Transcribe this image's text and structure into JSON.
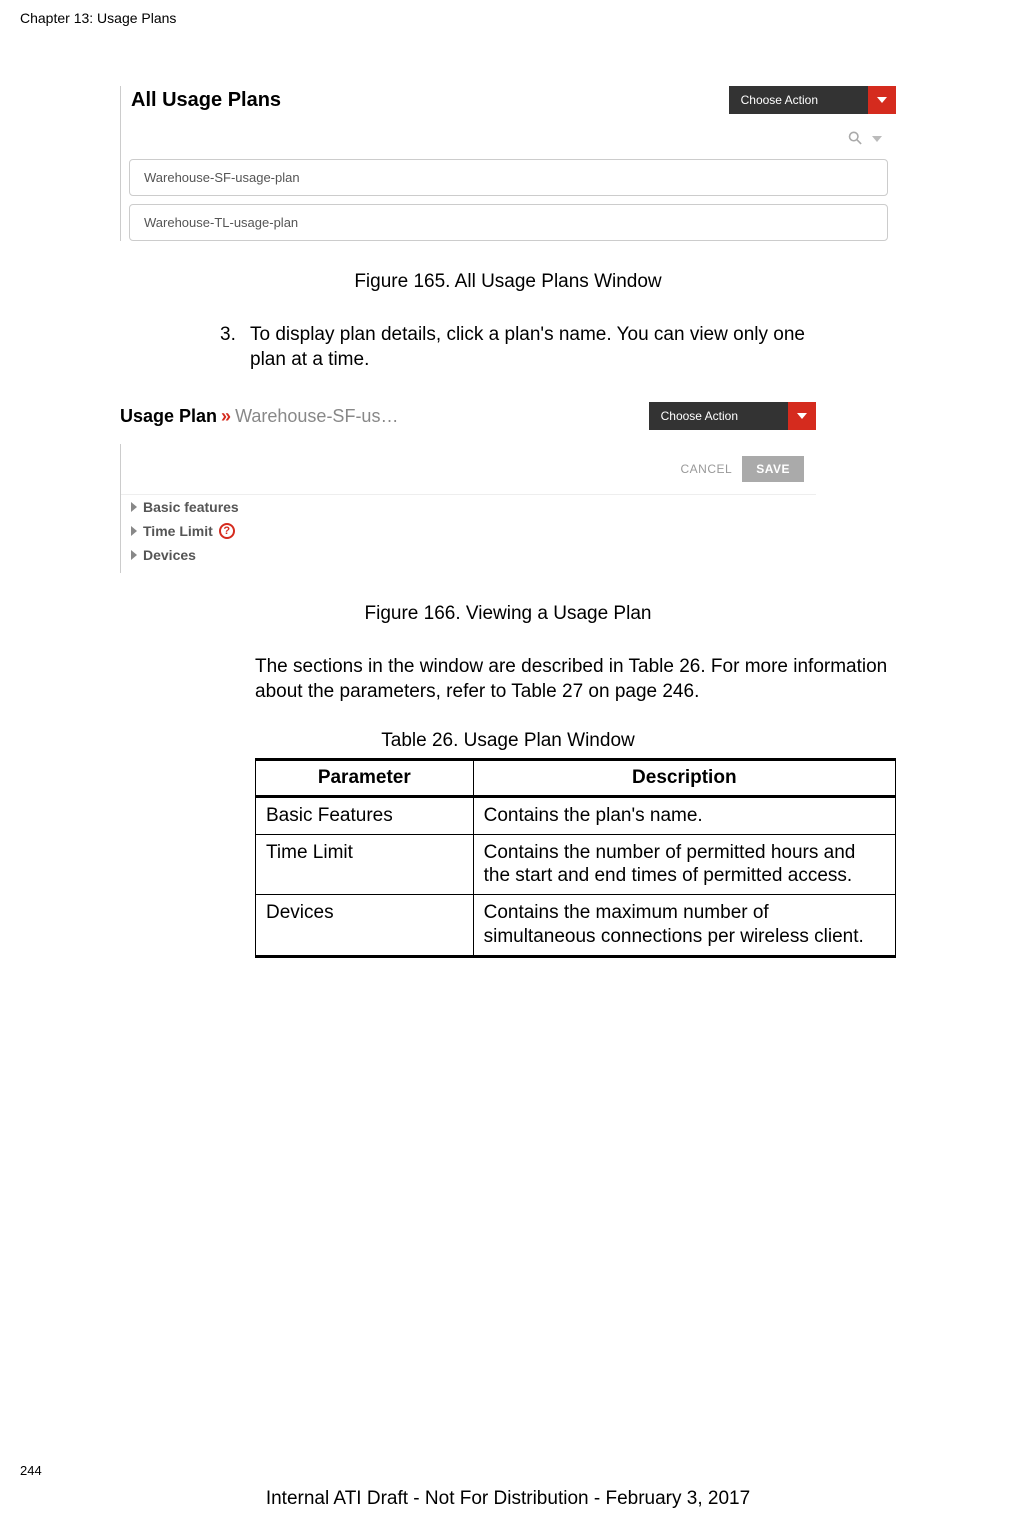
{
  "header": {
    "chapter": "Chapter 13: Usage Plans"
  },
  "figure1": {
    "title": "All Usage Plans",
    "choose_action": "Choose Action",
    "items": [
      "Warehouse-SF-usage-plan",
      "Warehouse-TL-usage-plan"
    ],
    "caption": "Figure 165. All Usage Plans Window"
  },
  "step": {
    "num": "3.",
    "text_line1": "To display plan details, click a plan's name. You can view only one",
    "text_line2": "plan at a time."
  },
  "figure2": {
    "bc_strong": "Usage Plan",
    "bc_chev": "»",
    "bc_muted": "Warehouse-SF-us…",
    "choose_action": "Choose Action",
    "cancel": "CANCEL",
    "save": "SAVE",
    "rows": {
      "basic": "Basic features",
      "time": "Time Limit",
      "devices": "Devices"
    },
    "caption": "Figure 166. Viewing a Usage Plan"
  },
  "paragraph": "The sections in the window are described in Table 26. For more information about the parameters, refer to Table 27 on page 246.",
  "table": {
    "caption": "Table 26. Usage Plan Window",
    "headers": {
      "param": "Parameter",
      "desc": "Description"
    },
    "rows": [
      {
        "param": "Basic Features",
        "desc": "Contains the plan's name."
      },
      {
        "param": "Time Limit",
        "desc": "Contains the number of permitted hours and the start and end times of permitted access."
      },
      {
        "param": "Devices",
        "desc": "Contains the maximum number of simultaneous connections per wireless client."
      }
    ]
  },
  "footer": {
    "page": "244",
    "text": "Internal ATI Draft - Not For Distribution - February 3, 2017"
  },
  "icons": {
    "search": "⚲",
    "help": "?"
  }
}
